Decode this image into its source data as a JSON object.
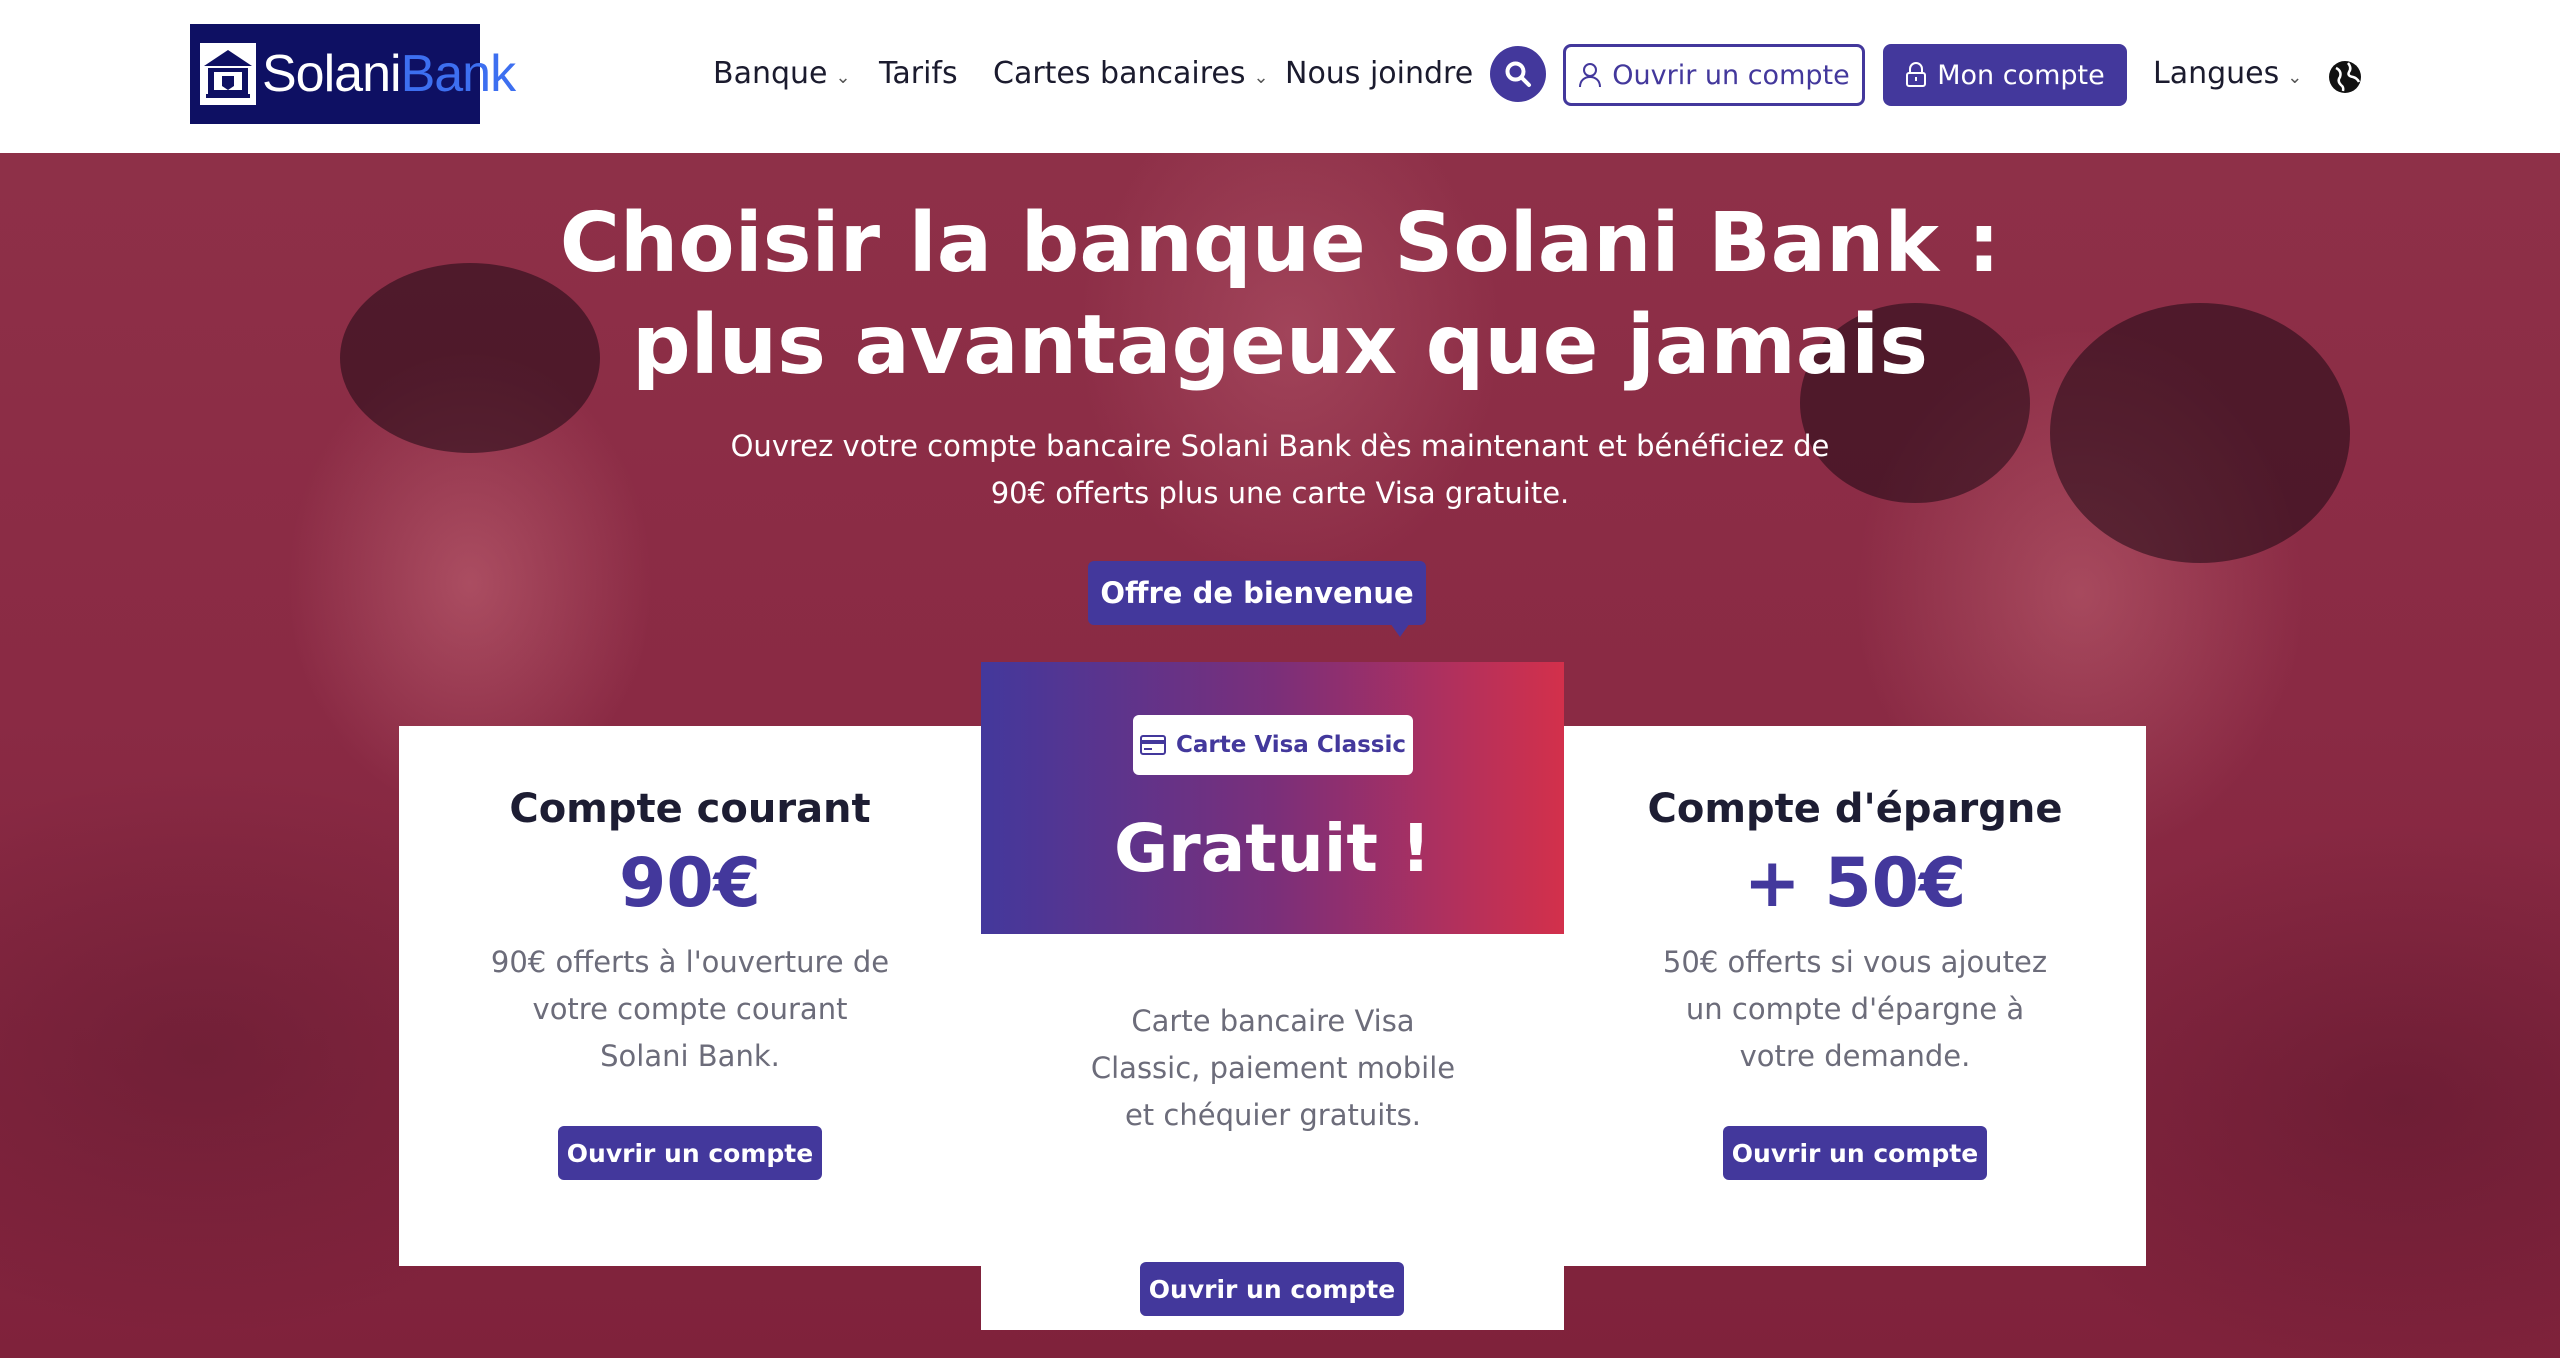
{
  "brand": {
    "logo_text_1": "Solani",
    "logo_text_2": "Bank"
  },
  "nav": {
    "items": [
      {
        "label": "Banque",
        "has_dropdown": true
      },
      {
        "label": "Tarifs",
        "has_dropdown": false
      },
      {
        "label": "Cartes bancaires",
        "has_dropdown": true
      },
      {
        "label": "Nous joindre",
        "has_dropdown": false
      }
    ],
    "open_account_label": "Ouvrir un compte",
    "my_account_label": "Mon compte",
    "languages_label": "Langues",
    "icons": {
      "search": "search-icon",
      "user": "user-icon",
      "lock": "lock-icon",
      "globe": "globe-icon"
    }
  },
  "hero": {
    "title": "Choisir la banque Solani Bank : plus avantageux que jamais",
    "subtitle": "Ouvrez votre compte bancaire Solani Bank dès maintenant et bénéficiez de 90€ offerts plus une carte Visa gratuite.",
    "cta_label": "Offre de bienvenue"
  },
  "cards": {
    "left": {
      "title": "Compte courant",
      "amount": "90€",
      "text": "90€ offerts à l'ouverture de votre compte courant Solani Bank.",
      "button": "Ouvrir un compte"
    },
    "middle": {
      "badge": "Carte Visa Classic",
      "headline": "Gratuit !",
      "text": "Carte bancaire Visa Classic, paiement mobile et chéquier gratuits.",
      "button": "Ouvrir un compte"
    },
    "right": {
      "title": "Compte d'épargne",
      "amount": "+ 50€",
      "text": "50€ offerts si vous ajoutez un compte d'épargne à votre demande.",
      "button": "Ouvrir un compte"
    }
  },
  "colors": {
    "primary": "#43389c",
    "accent_red": "#d3304b",
    "logo_bg": "#0e1063",
    "hero_overlay": "#8a2a44"
  }
}
